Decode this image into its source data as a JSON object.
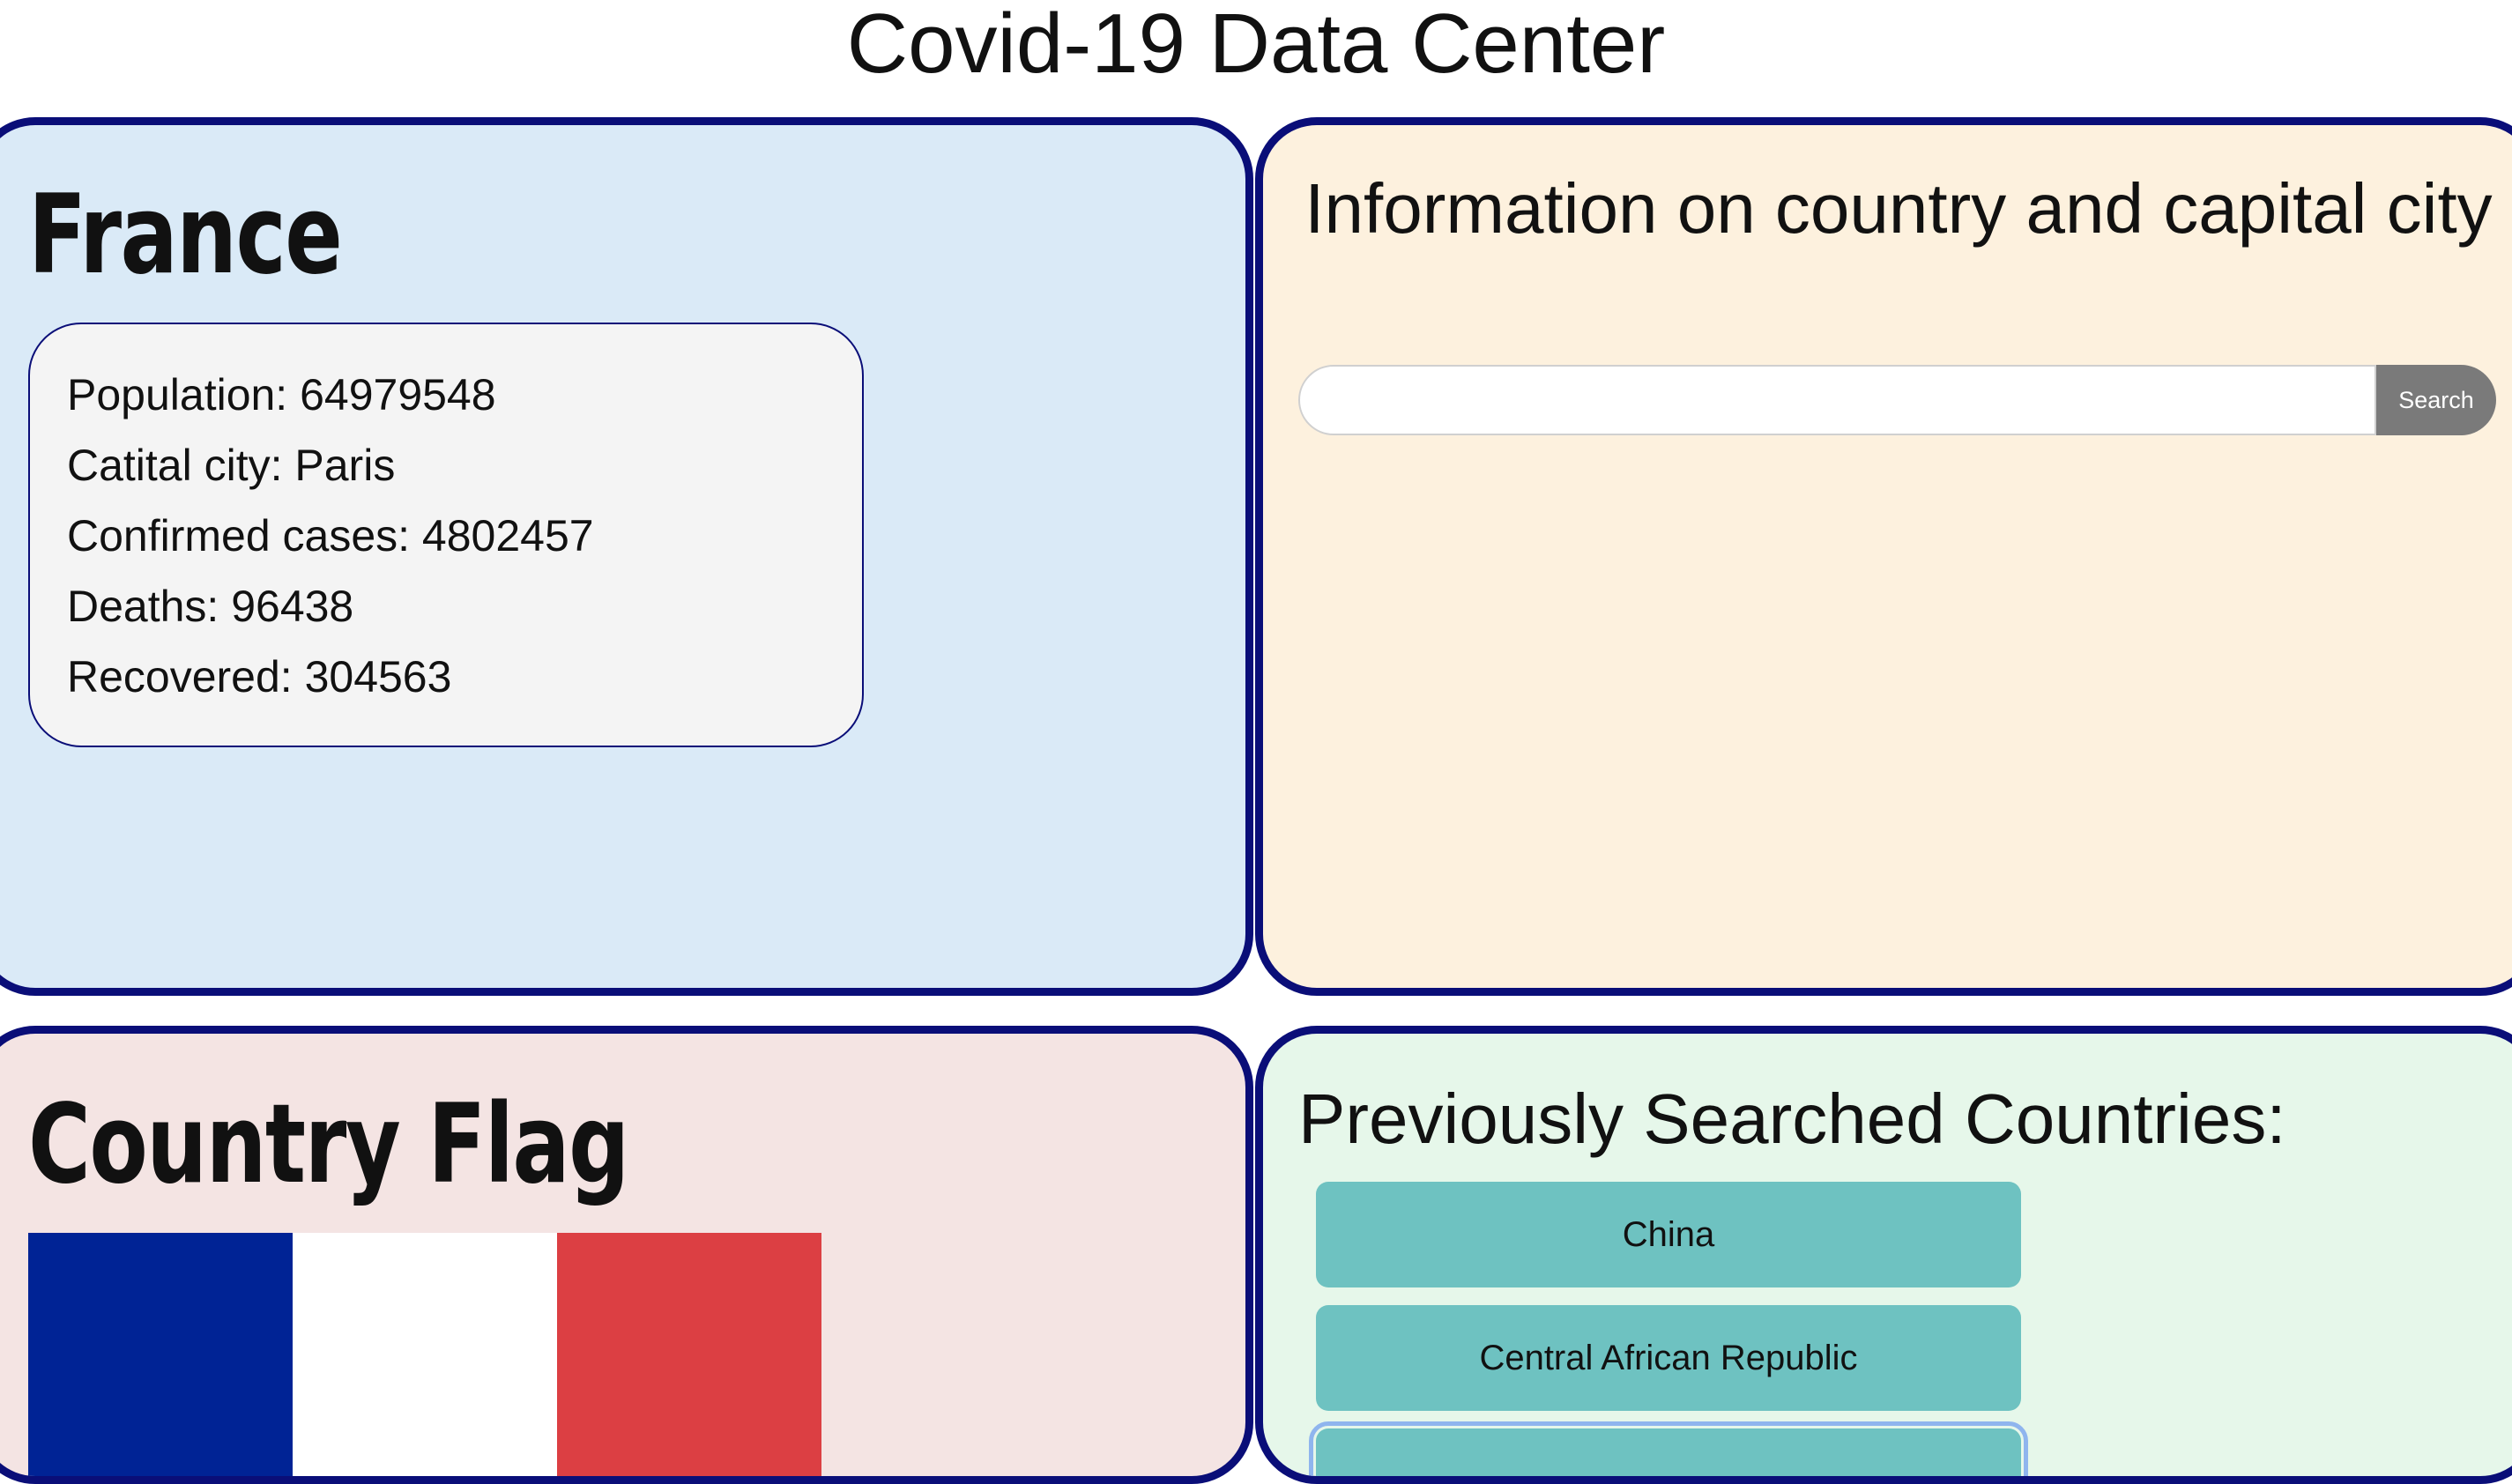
{
  "page": {
    "title": "Covid-19 Data Center"
  },
  "country_panel": {
    "name": "France",
    "stats": [
      "Population: 64979548",
      "Catital city: Paris",
      "Confirmed cases: 4802457",
      "Deaths: 96438",
      "Recovered: 304563"
    ]
  },
  "info_panel": {
    "title": "Information on country and capital city",
    "search": {
      "value": "",
      "button_label": "Search"
    }
  },
  "flag_panel": {
    "title": "Country Flag",
    "flag_colors": [
      "#002395",
      "#ffffff",
      "#dc3f43"
    ]
  },
  "history_panel": {
    "title": "Previously Searched Countries:",
    "items": [
      "China",
      "Central African Republic",
      ""
    ]
  },
  "colors": {
    "panel_border": "#0a0e78",
    "country_bg": "#daeaf7",
    "info_bg": "#fdf1de",
    "flag_bg": "#f4e4e3",
    "history_bg": "#e6f7ea",
    "history_button": "#6ec2c1",
    "search_button": "#7a7a7a"
  }
}
